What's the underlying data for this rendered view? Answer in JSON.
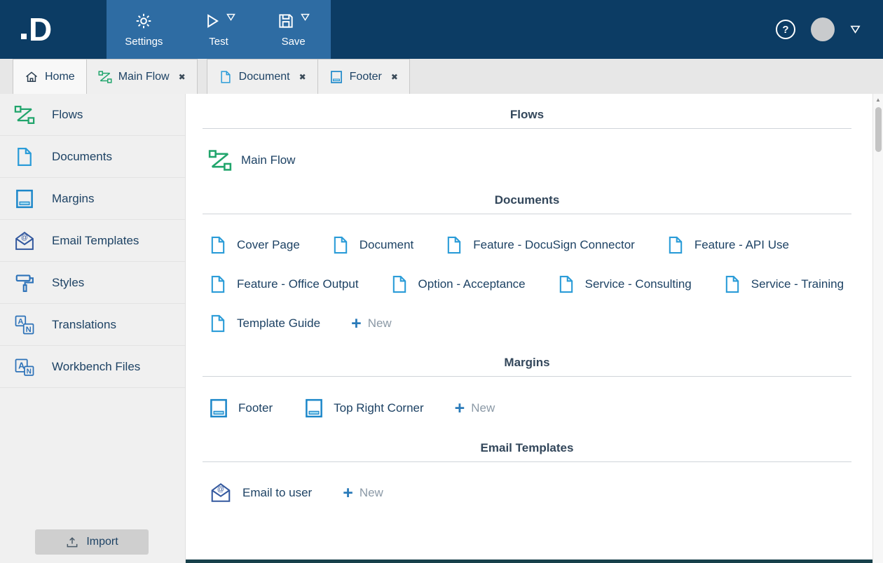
{
  "icons": {
    "help": "?",
    "close": "✖",
    "plus": "+",
    "scroll_up": "▲"
  },
  "colors": {
    "topbar": "#0c3c64",
    "toolbar_panel": "#2e6ca3",
    "accent_green": "#21a56c",
    "accent_blue": "#2b9cd8",
    "text_navy": "#1d4264"
  },
  "topbar": {
    "logo": "D",
    "settings_label": "Settings",
    "test_label": "Test",
    "save_label": "Save"
  },
  "tabs": [
    {
      "label": "Home",
      "icon": "home",
      "closable": false
    },
    {
      "label": "Main Flow",
      "icon": "flow",
      "closable": true
    },
    {
      "label": "Document",
      "icon": "document",
      "closable": true
    },
    {
      "label": "Footer",
      "icon": "margin",
      "closable": true
    }
  ],
  "sidebar": {
    "items": [
      {
        "label": "Flows",
        "icon": "flow"
      },
      {
        "label": "Documents",
        "icon": "document"
      },
      {
        "label": "Margins",
        "icon": "margin"
      },
      {
        "label": "Email Templates",
        "icon": "email"
      },
      {
        "label": "Styles",
        "icon": "styles"
      },
      {
        "label": "Translations",
        "icon": "translations"
      },
      {
        "label": "Workbench Files",
        "icon": "workbench"
      }
    ],
    "import_label": "Import"
  },
  "main": {
    "new_label": "New",
    "sections": [
      {
        "title": "Flows",
        "icon": "flow",
        "items": [
          "Main Flow"
        ],
        "has_new": false
      },
      {
        "title": "Documents",
        "icon": "document",
        "items": [
          "Cover Page",
          "Document",
          "Feature - DocuSign Connector",
          "Feature - API Use",
          "Feature - Office Output",
          "Option - Acceptance",
          "Service - Consulting",
          "Service - Training",
          "Template Guide"
        ],
        "has_new": true
      },
      {
        "title": "Margins",
        "icon": "margin",
        "items": [
          "Footer",
          "Top Right Corner"
        ],
        "has_new": true
      },
      {
        "title": "Email Templates",
        "icon": "email",
        "items": [
          "Email to user"
        ],
        "has_new": true
      }
    ]
  }
}
